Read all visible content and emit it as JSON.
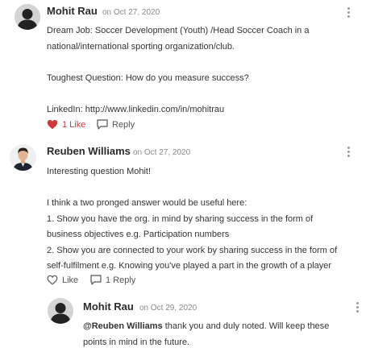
{
  "comments": [
    {
      "author": "Mohit Rau",
      "date": "on Oct 27, 2020",
      "lines": [
        "Dream Job: Soccer Development (Youth) /Head Soccer Coach in a",
        "national/international sporting organization/club.",
        "",
        "Toughest Question: How do you measure success?",
        ""
      ],
      "linkedin_label": "LinkedIn:",
      "linkedin_url": "http://www.linkedin.com/in/mohitrau",
      "like_label": "1 Like",
      "reply_label": "Reply"
    },
    {
      "author": "Reuben Williams",
      "date": "on Oct 27, 2020",
      "lines": [
        "Interesting question Mohit!",
        "",
        "I think a two pronged answer would be useful here:",
        "1. Show you have the org. in mind by sharing success in the form of",
        "business objectives e.g. Participation numbers",
        "2. Show you are connected to your work by sharing success in the form of",
        "self-fulfilment e.g. Knowing you've played a part in the growth of a player"
      ],
      "like_label": "Like",
      "reply_label": "1 Reply"
    },
    {
      "author": "Mohit Rau",
      "date": "on Oct 29, 2020",
      "mention": "@Reuben Williams",
      "line1_rest": " thank you and duly noted. Will keep these",
      "line2": "points in mind in the future."
    }
  ],
  "icons": {
    "kebab": "more-vertical-icon",
    "heart": "heart-icon",
    "reply": "speech-bubble-icon"
  },
  "colors": {
    "liked": "#d0393b",
    "meta": "#8a8a8a",
    "text": "#333333"
  }
}
